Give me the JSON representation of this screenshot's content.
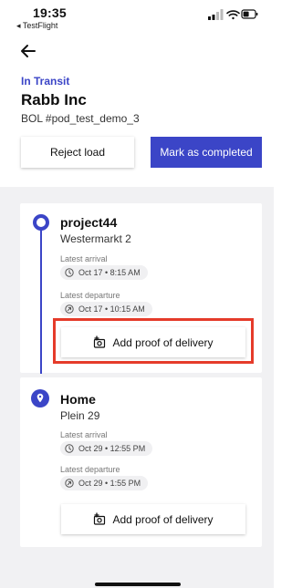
{
  "statusbar": {
    "time": "19:35",
    "back_app": "◂ TestFlight"
  },
  "header": {
    "status": "In Transit",
    "company": "Rabb Inc",
    "bol": "BOL #pod_test_demo_3"
  },
  "actions": {
    "reject_label": "Reject load",
    "complete_label": "Mark as completed"
  },
  "colors": {
    "accent": "#3b45c7",
    "highlight": "#e53b2a"
  },
  "stops": [
    {
      "name": "project44",
      "address": "Westermarkt 2",
      "arrival_label": "Latest arrival",
      "arrival_value": "Oct 17 • 8:15 AM",
      "departure_label": "Latest departure",
      "departure_value": "Oct 17 • 10:15 AM",
      "pod_label": "Add proof of delivery",
      "icon": "circle-dot-icon"
    },
    {
      "name": "Home",
      "address": "Plein 29",
      "arrival_label": "Latest arrival",
      "arrival_value": "Oct 29 • 12:55 PM",
      "departure_label": "Latest departure",
      "departure_value": "Oct 29 • 1:55 PM",
      "pod_label": "Add proof of delivery",
      "icon": "map-pin-icon"
    }
  ]
}
